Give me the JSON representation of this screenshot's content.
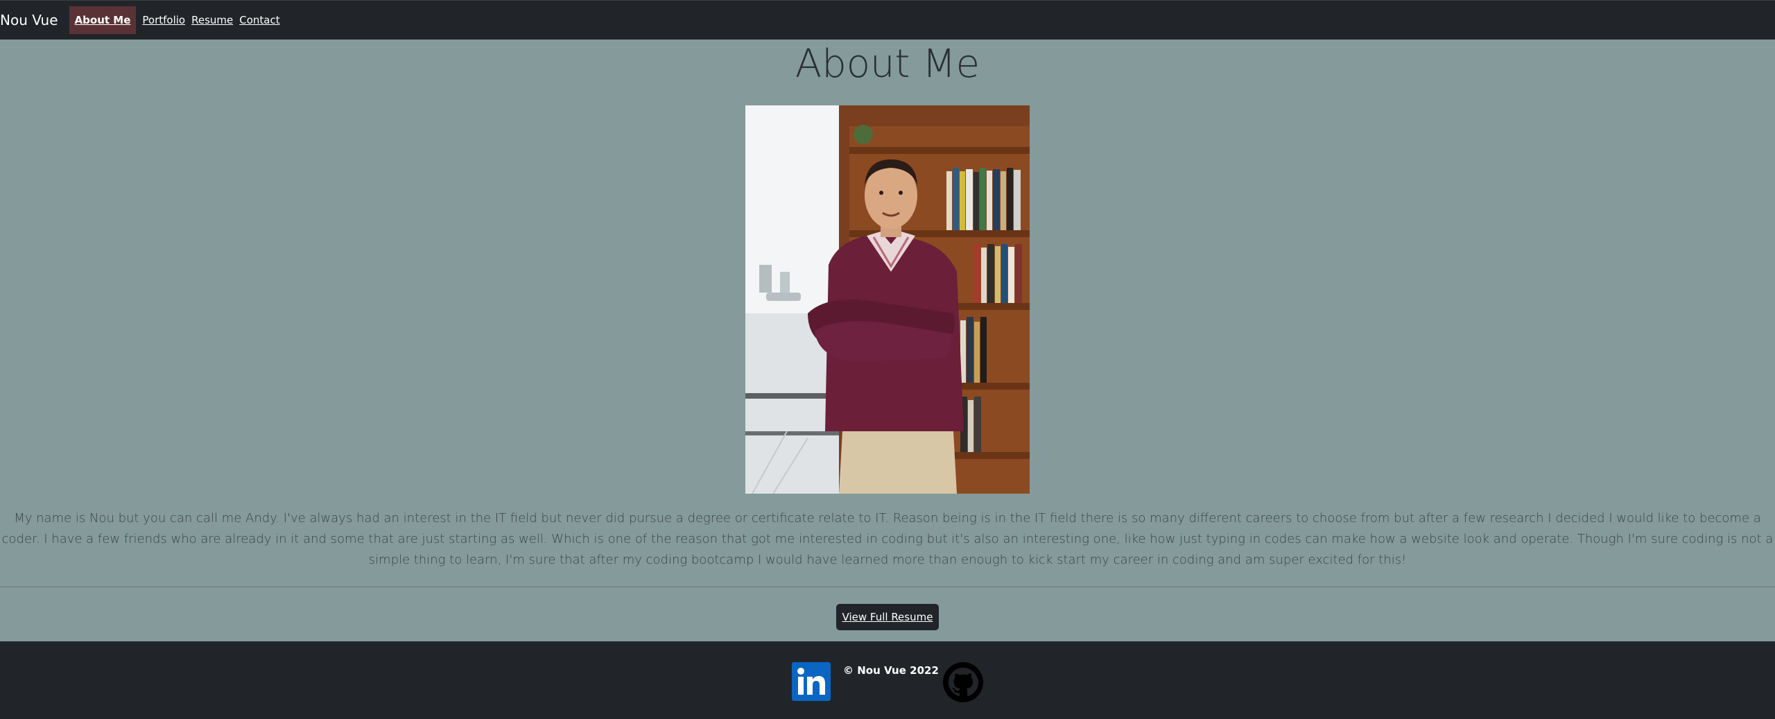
{
  "nav": {
    "brand": "Nou Vue",
    "items": [
      {
        "label": "About Me",
        "active": true
      },
      {
        "label": "Portfolio",
        "active": false
      },
      {
        "label": "Resume",
        "active": false
      },
      {
        "label": "Contact",
        "active": false
      }
    ]
  },
  "main": {
    "title": "About Me",
    "bio": "My name is Nou but you can call me Andy. I've always had an interest in the IT field but never did pursue a degree or certificate relate to IT. Reason being is in the IT field there is so many different careers to choose from but after a few research I decided I would like to become a coder. I have a few friends who are already in it and some that are just starting as well. Which is one of the reason that got me interested in coding but it's also an interesting one, like how just typing in codes can make how a website look and operate. Though I'm sure coding is not a simple thing to learn, I'm sure that after my coding bootcamp I would have learned more than enough to kick start my career in coding and am super excited for this!",
    "resume_button": "View Full Resume"
  },
  "footer": {
    "copyright": "© Nou Vue 2022",
    "icons": [
      "linkedin-icon",
      "github-icon"
    ]
  },
  "colors": {
    "background": "#849a9b",
    "navbar": "#212529",
    "active_nav": "#5a3236",
    "footer": "#212529",
    "linkedin": "#0a66c2"
  }
}
